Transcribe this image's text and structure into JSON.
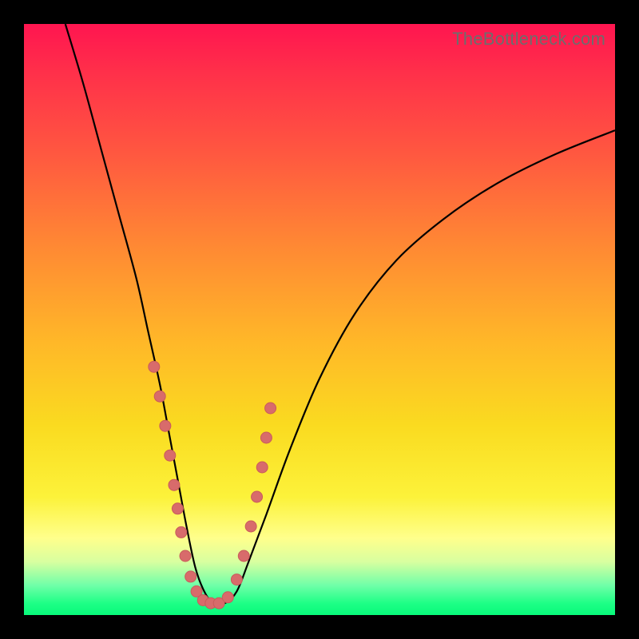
{
  "watermark": "TheBottleneck.com",
  "colors": {
    "frame": "#000000",
    "curve": "#000000",
    "marker_fill": "#d86b6b",
    "marker_stroke": "#c95b5b",
    "gradient_stops": [
      {
        "offset": 0.0,
        "color": "#ff1550"
      },
      {
        "offset": 0.08,
        "color": "#ff2f4a"
      },
      {
        "offset": 0.22,
        "color": "#ff5840"
      },
      {
        "offset": 0.38,
        "color": "#ff8a33"
      },
      {
        "offset": 0.54,
        "color": "#ffb828"
      },
      {
        "offset": 0.68,
        "color": "#fadb20"
      },
      {
        "offset": 0.8,
        "color": "#fcf23a"
      },
      {
        "offset": 0.87,
        "color": "#ffff8c"
      },
      {
        "offset": 0.91,
        "color": "#d8ffa0"
      },
      {
        "offset": 0.95,
        "color": "#6fffa8"
      },
      {
        "offset": 0.98,
        "color": "#1eff86"
      },
      {
        "offset": 1.0,
        "color": "#08f97a"
      }
    ]
  },
  "chart_data": {
    "type": "line",
    "title": "",
    "xlabel": "",
    "ylabel": "",
    "xlim": [
      0,
      100
    ],
    "ylim": [
      0,
      100
    ],
    "grid": false,
    "legend": false,
    "series": [
      {
        "name": "bottleneck-curve",
        "x": [
          7,
          10,
          13,
          16,
          19,
          21,
          23,
          24.5,
          26,
          27.5,
          29,
          30.5,
          32,
          34,
          36,
          38,
          41,
          45,
          50,
          56,
          63,
          71,
          80,
          90,
          100
        ],
        "y": [
          100,
          90,
          79,
          68,
          57,
          48,
          39,
          31,
          23,
          15,
          8,
          4,
          2,
          2,
          4,
          9,
          17,
          28,
          40,
          51,
          60,
          67,
          73,
          78,
          82
        ]
      }
    ],
    "markers": {
      "name": "highlight-dots",
      "x": [
        22.0,
        23.0,
        23.9,
        24.7,
        25.4,
        26.0,
        26.6,
        27.3,
        28.2,
        29.2,
        30.3,
        31.6,
        33.0,
        34.5,
        36.0,
        37.2,
        38.4,
        39.4,
        40.3,
        41.0,
        41.7
      ],
      "y": [
        42.0,
        37.0,
        32.0,
        27.0,
        22.0,
        18.0,
        14.0,
        10.0,
        6.5,
        4.0,
        2.5,
        2.0,
        2.0,
        3.0,
        6.0,
        10.0,
        15.0,
        20.0,
        25.0,
        30.0,
        35.0
      ]
    }
  }
}
